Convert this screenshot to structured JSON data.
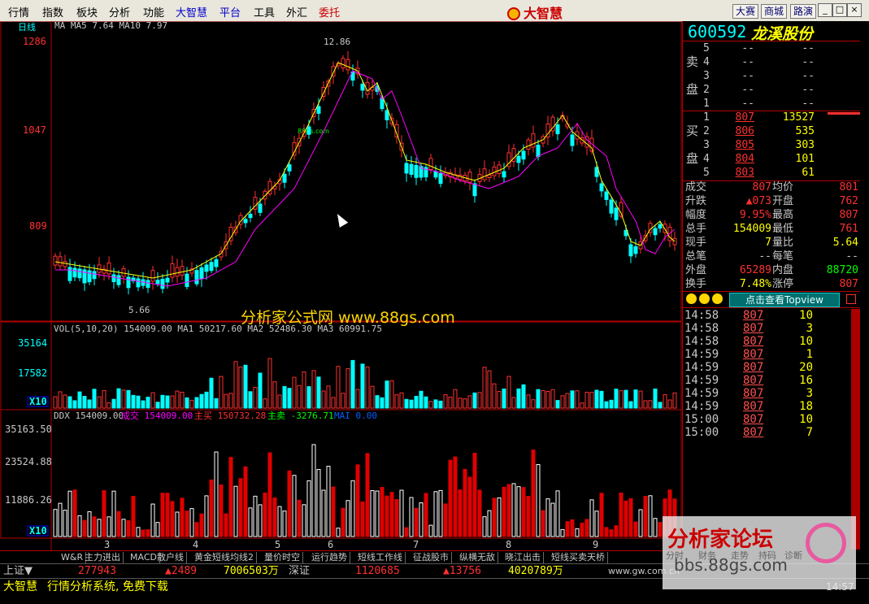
{
  "menubar": {
    "items": [
      "行情",
      "指数",
      "板块",
      "分析",
      "功能",
      "大智慧",
      "平台",
      "工具",
      "外汇",
      "委托"
    ],
    "brand": "大智慧",
    "links": [
      "大赛",
      "商城",
      "路演"
    ],
    "window_buttons": [
      "_",
      "□",
      "×"
    ]
  },
  "colors": {
    "up": "#ff3030",
    "down": "#00ffff",
    "ma5": "#ffff00",
    "ma10": "#ff00ff",
    "grid": "#b00000",
    "text": "#c8c8c8"
  },
  "main_chart": {
    "period": "日线",
    "indicator_header": "MA MA5 7.64 MA10 7.97",
    "y_labels": [
      "1286",
      "1047",
      "809"
    ],
    "high_label": "12.86",
    "low_label": "5.66",
    "x_labels": [
      "3",
      "4",
      "5",
      "6",
      "7",
      "8",
      "9"
    ],
    "watermark": "分析家公式网 www.88gs.com",
    "site_mark": "88gs.com"
  },
  "volume_panel": {
    "header": "VOL(5,10,20) 154009.00 MA1 50217.60 MA2 52486.30 MA3 60991.75",
    "y_labels": [
      "35164",
      "17582"
    ],
    "scale": "X10"
  },
  "ddx_panel": {
    "header_parts": [
      {
        "t": "DDX 154009.00",
        "c": "#c8c8c8"
      },
      {
        "t": "成交 154009.00",
        "c": "#ff00ff"
      },
      {
        "t": "主买 150732.28",
        "c": "#ff3030"
      },
      {
        "t": "主卖 -3276.71",
        "c": "#00ff00"
      },
      {
        "t": "MAI 0.00",
        "c": "#0060ff"
      }
    ],
    "y_labels": [
      "35163.50",
      "23524.88",
      "11886.26"
    ],
    "scale": "X10"
  },
  "tabs": [
    "W&R",
    "主力进出",
    "MACD",
    "散户线",
    "黄金短线均线2",
    "量价时空",
    "运行趋势",
    "短线工作线",
    "征战股市",
    "纵横无敌",
    "晓江出击",
    "短线买卖天桥"
  ],
  "quote": {
    "code": "600592",
    "name": "龙溪股份",
    "sell_label": [
      "卖",
      "盘"
    ],
    "buy_label": [
      "买",
      "盘"
    ],
    "sell": [
      {
        "lv": "5",
        "price": "--",
        "vol": "--"
      },
      {
        "lv": "4",
        "price": "--",
        "vol": "--"
      },
      {
        "lv": "3",
        "price": "--",
        "vol": "--"
      },
      {
        "lv": "2",
        "price": "--",
        "vol": "--"
      },
      {
        "lv": "1",
        "price": "--",
        "vol": "--"
      }
    ],
    "buy": [
      {
        "lv": "1",
        "price": "807",
        "vol": "13527"
      },
      {
        "lv": "2",
        "price": "806",
        "vol": "535"
      },
      {
        "lv": "3",
        "price": "805",
        "vol": "303"
      },
      {
        "lv": "4",
        "price": "804",
        "vol": "101"
      },
      {
        "lv": "5",
        "price": "803",
        "vol": "61"
      }
    ],
    "stats": [
      {
        "l1": "成交",
        "v1": "807",
        "c1": "#ff3030",
        "l2": "均价",
        "v2": "801",
        "c2": "#ff3030"
      },
      {
        "l1": "升跌",
        "v1": "▲073",
        "c1": "#ff3030",
        "l2": "开盘",
        "v2": "762",
        "c2": "#ff3030"
      },
      {
        "l1": "幅度",
        "v1": "9.95%",
        "c1": "#ff3030",
        "l2": "最高",
        "v2": "807",
        "c2": "#ff3030"
      },
      {
        "l1": "总手",
        "v1": "154009",
        "c1": "#ffff00",
        "l2": "最低",
        "v2": "761",
        "c2": "#ff3030"
      },
      {
        "l1": "现手",
        "v1": "7",
        "c1": "#ffff00",
        "l2": "量比",
        "v2": "5.64",
        "c2": "#ffff00"
      },
      {
        "l1": "总笔",
        "v1": "--",
        "c1": "#c8c8c8",
        "l2": "每笔",
        "v2": "--",
        "c2": "#c8c8c8"
      },
      {
        "l1": "外盘",
        "v1": "65289",
        "c1": "#ff3030",
        "l2": "内盘",
        "v2": "88720",
        "c2": "#00ff00"
      },
      {
        "l1": "换手",
        "v1": "7.48%",
        "c1": "#ffff00",
        "l2": "涨停",
        "v2": "807",
        "c2": "#ff3030"
      }
    ],
    "topview_button": "点击查看Topview"
  },
  "ticks": [
    {
      "time": "14:58",
      "price": "807",
      "vol": "10"
    },
    {
      "time": "14:58",
      "price": "807",
      "vol": "3"
    },
    {
      "time": "14:58",
      "price": "807",
      "vol": "10"
    },
    {
      "time": "14:59",
      "price": "807",
      "vol": "1"
    },
    {
      "time": "14:59",
      "price": "807",
      "vol": "20"
    },
    {
      "time": "14:59",
      "price": "807",
      "vol": "16"
    },
    {
      "time": "14:59",
      "price": "807",
      "vol": "3"
    },
    {
      "time": "14:59",
      "price": "807",
      "vol": "18"
    },
    {
      "time": "15:00",
      "price": "807",
      "vol": "10"
    },
    {
      "time": "15:00",
      "price": "807",
      "vol": "7"
    }
  ],
  "status1": {
    "market": "上证▼",
    "index1": "277943",
    "chg1": "▲2489",
    "amt1": "7006503万",
    "market2": "深证",
    "index2": "1120685",
    "chg2": "▲13756",
    "amt2": "4020789万",
    "site": "www.gw.com.cn"
  },
  "status2": {
    "brand": "大智慧",
    "tagline": "行情分析系统, 免费下载",
    "forum_title": "分析家论坛",
    "forum_site": "bbs.88gs.com",
    "forum_menu": [
      "分时",
      "财务",
      "走势",
      "持码",
      "诊断"
    ],
    "clock": "14:57"
  }
}
